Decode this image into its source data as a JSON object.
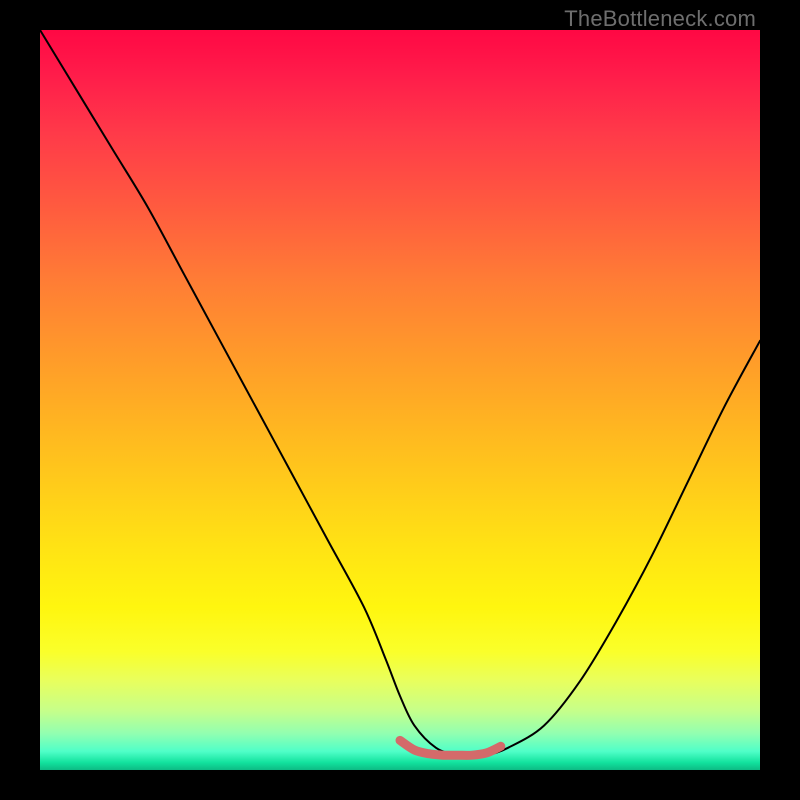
{
  "watermark": "TheBottleneck.com",
  "chart_data": {
    "type": "line",
    "title": "",
    "xlabel": "",
    "ylabel": "",
    "xlim": [
      0,
      100
    ],
    "ylim": [
      0,
      100
    ],
    "gradient_colors": {
      "top": "#ff0844",
      "mid_upper": "#ff7d35",
      "mid": "#ffe314",
      "lower": "#c6ff8a",
      "bottom": "#0dbb84"
    },
    "series": [
      {
        "name": "bottleneck-curve",
        "color": "#000000",
        "stroke_width": 2,
        "x": [
          0,
          5,
          10,
          15,
          20,
          25,
          30,
          35,
          40,
          45,
          48,
          50,
          52,
          55,
          58,
          60,
          62,
          65,
          70,
          75,
          80,
          85,
          90,
          95,
          100
        ],
        "values": [
          100,
          92,
          84,
          76,
          67,
          58,
          49,
          40,
          31,
          22,
          15,
          10,
          6,
          3,
          2,
          2,
          2,
          3,
          6,
          12,
          20,
          29,
          39,
          49,
          58
        ]
      },
      {
        "name": "sweet-spot-marker",
        "color": "#d46a6a",
        "stroke_width": 9,
        "x": [
          50,
          52,
          54,
          56,
          58,
          60,
          62,
          64
        ],
        "values": [
          4,
          2.7,
          2.2,
          2.0,
          2.0,
          2.0,
          2.3,
          3.2
        ]
      }
    ]
  }
}
